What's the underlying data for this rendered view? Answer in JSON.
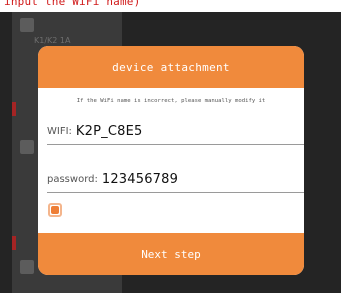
{
  "caption": "input the WiFi name)",
  "background": {
    "item_label": "K1/K2 1A"
  },
  "dialog": {
    "title": "device attachment",
    "hint": "If the WiFi name is incorrect, please manually modify it",
    "wifi": {
      "label": "WIFI:",
      "value": "K2P_C8E5"
    },
    "password": {
      "label": "password:",
      "value": "123456789"
    },
    "remember_checked": true,
    "next_label": "Next step"
  },
  "colors": {
    "accent": "#f08a3c",
    "overlay": "#242424",
    "caption": "#d01818"
  }
}
